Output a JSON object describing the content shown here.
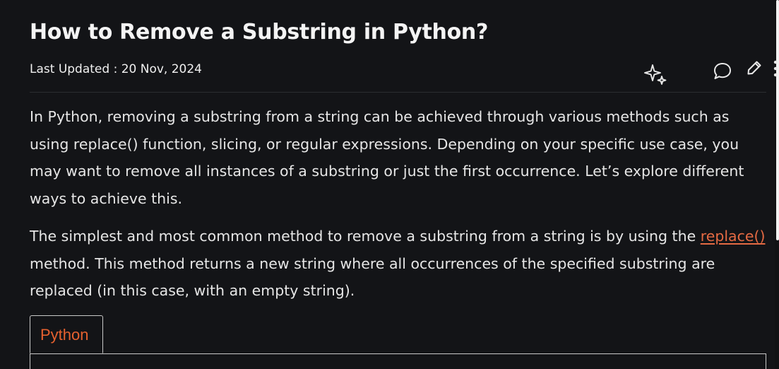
{
  "article": {
    "title": "How to Remove a Substring in Python?",
    "last_updated": "Last Updated : 20 Nov, 2024",
    "paragraph1": "In Python, removing a substring from a string can be achieved through various methods such as using replace() function, slicing, or regular expressions. Depending on your specific use case, you may want to remove all instances of a substring or just the first occurrence. Let’s explore different ways to achieve this.",
    "paragraph2_before": "The simplest and most common method to remove a substring from a string is by using the",
    "paragraph2_link": "replace()",
    "paragraph2_after": "method. This method returns a new string where all occurrences of the specified substring are replaced (in this case, with an empty string)."
  },
  "actions": {
    "icons": [
      "ai-sparkle-icon",
      "comment-icon",
      "edit-pencil-icon",
      "more-vertical-icon"
    ]
  },
  "code_block": {
    "tabs": [
      {
        "label": "Python",
        "active": true
      }
    ]
  },
  "colors": {
    "background": "#131417",
    "text": "#e6e6e6",
    "link": "#e56a43",
    "tab_active": "#e5612f",
    "border": "#c9c9c9"
  }
}
